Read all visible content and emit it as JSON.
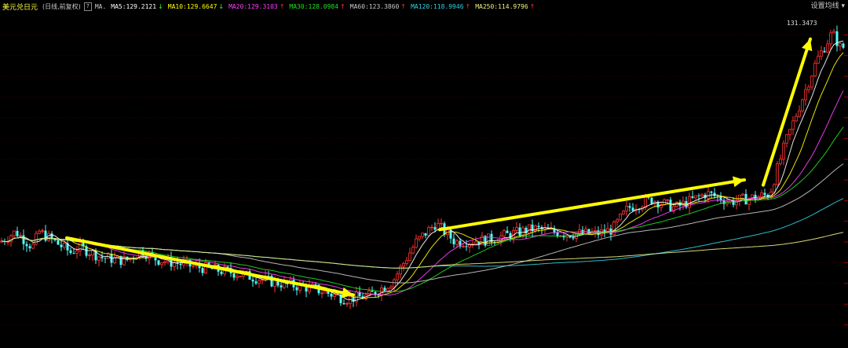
{
  "header": {
    "symbol": "美元兑日元",
    "period": "(日线,前复权)",
    "help": "?",
    "ma_label": "MA.",
    "ma_items": [
      {
        "text": "MA5:129.2121",
        "arrow": "↓",
        "color": "#ffffff"
      },
      {
        "text": "MA10:129.6647",
        "arrow": "↓",
        "color": "#ffff00"
      },
      {
        "text": "MA20:129.3103",
        "arrow": "↑",
        "color": "#ff40ff"
      },
      {
        "text": "MA30:128.0984",
        "arrow": "↑",
        "color": "#20e020"
      },
      {
        "text": "MA60:123.3860",
        "arrow": "↑",
        "color": "#c8c8c8"
      },
      {
        "text": "MA120:118.9946",
        "arrow": "↑",
        "color": "#30d0e0"
      },
      {
        "text": "MA250:114.9796",
        "arrow": "↑",
        "color": "#f0f080"
      }
    ],
    "settings_label": "设置均线",
    "settings_caret": "▾"
  },
  "chart_data": {
    "type": "candlestick",
    "instrument": "美元兑日元",
    "max_label": "131.3473",
    "ylim": [
      101,
      133
    ],
    "anchors": [
      [
        0,
        111
      ],
      [
        20,
        112
      ],
      [
        40,
        110.6
      ],
      [
        41,
        106
      ],
      [
        42,
        110.6
      ],
      [
        50,
        112
      ],
      [
        70,
        111
      ],
      [
        90,
        110
      ],
      [
        100,
        110.5
      ],
      [
        110,
        110.2
      ],
      [
        130,
        109.5
      ],
      [
        160,
        109.2
      ],
      [
        180,
        110.2
      ],
      [
        200,
        109.3
      ],
      [
        250,
        108.6
      ],
      [
        300,
        108
      ],
      [
        350,
        107.1
      ],
      [
        400,
        106.5
      ],
      [
        440,
        105.5
      ],
      [
        470,
        105.8
      ],
      [
        500,
        107.2
      ],
      [
        530,
        111
      ],
      [
        555,
        112.8
      ],
      [
        580,
        111
      ],
      [
        620,
        111.2
      ],
      [
        680,
        112.3
      ],
      [
        720,
        111.8
      ],
      [
        760,
        111.8
      ],
      [
        780,
        112.2
      ],
      [
        800,
        114.3
      ],
      [
        830,
        115.1
      ],
      [
        860,
        114.3
      ],
      [
        900,
        115.7
      ],
      [
        930,
        114.9
      ],
      [
        960,
        115.3
      ],
      [
        980,
        115.6
      ],
      [
        1000,
        120.5
      ],
      [
        1020,
        124.5
      ],
      [
        1040,
        128.5
      ],
      [
        1060,
        131.2
      ],
      [
        1070,
        129.8
      ]
    ],
    "candles_step": 4,
    "ma_series": [
      {
        "name": "MA5",
        "color": "#ffffff",
        "period": 5
      },
      {
        "name": "MA10",
        "color": "#ffff00",
        "period": 10
      },
      {
        "name": "MA20",
        "color": "#ff40ff",
        "period": 20
      },
      {
        "name": "MA30",
        "color": "#20e020",
        "period": 30
      },
      {
        "name": "MA60",
        "color": "#c8c8c8",
        "period": 60
      },
      {
        "name": "MA120",
        "color": "#30d0e0",
        "period": 120
      },
      {
        "name": "MA250",
        "color": "#f0f080",
        "period": 250
      }
    ],
    "annotations": [
      {
        "type": "arrow",
        "color": "#ffff00",
        "from": [
          85,
          111.4
        ],
        "to": [
          450,
          105.9
        ]
      },
      {
        "type": "arrow",
        "color": "#ffff00",
        "from": [
          560,
          112.2
        ],
        "to": [
          948,
          117
        ]
      },
      {
        "type": "arrow",
        "color": "#ffff00",
        "from": [
          972,
          116.5
        ],
        "to": [
          1032,
          130.6
        ]
      }
    ],
    "grid": true,
    "up_color": "#ff3232",
    "down_color": "#54fcfc"
  }
}
